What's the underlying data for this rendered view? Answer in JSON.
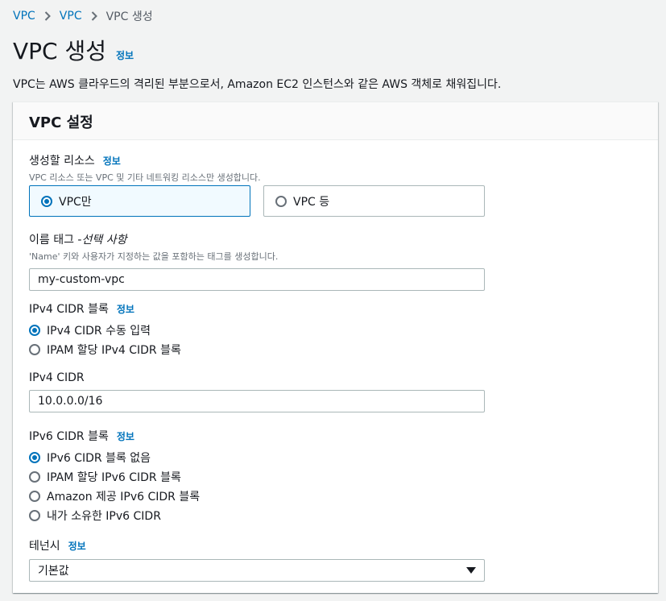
{
  "breadcrumb": {
    "items": [
      "VPC",
      "VPC",
      "VPC 생성"
    ]
  },
  "page": {
    "title": "VPC 생성",
    "info": "정보",
    "description": "VPC는 AWS 클라우드의 격리된 부분으로서, Amazon EC2 인스턴스와 같은 AWS 객체로 채워집니다."
  },
  "panel": {
    "title": "VPC 설정"
  },
  "resources": {
    "label": "생성할 리소스",
    "info": "정보",
    "hint": "VPC 리소스 또는 VPC 및 기타 네트워킹 리소스만 생성합니다.",
    "options": [
      "VPC만",
      "VPC 등"
    ],
    "selected": "VPC만"
  },
  "name_tag": {
    "label": "이름 태그 - ",
    "optional": "선택 사항",
    "hint": "'Name' 키와 사용자가 지정하는 값을 포함하는 태그를 생성합니다.",
    "value": "my-custom-vpc"
  },
  "ipv4_block": {
    "label": "IPv4 CIDR 블록",
    "info": "정보",
    "options": [
      "IPv4 CIDR 수동 입력",
      "IPAM 할당 IPv4 CIDR 블록"
    ],
    "selected": "IPv4 CIDR 수동 입력"
  },
  "ipv4_cidr": {
    "label": "IPv4 CIDR",
    "value": "10.0.0.0/16"
  },
  "ipv6_block": {
    "label": "IPv6 CIDR 블록",
    "info": "정보",
    "options": [
      "IPv6 CIDR 블록 없음",
      "IPAM 할당 IPv6 CIDR 블록",
      "Amazon 제공 IPv6 CIDR 블록",
      "내가 소유한 IPv6 CIDR"
    ],
    "selected": "IPv6 CIDR 블록 없음"
  },
  "tenancy": {
    "label": "테넌시",
    "info": "정보",
    "value": "기본값"
  },
  "colors": {
    "link": "#0073bb",
    "selected_tile_bg": "#f1faff",
    "background": "#f2f3f3"
  }
}
